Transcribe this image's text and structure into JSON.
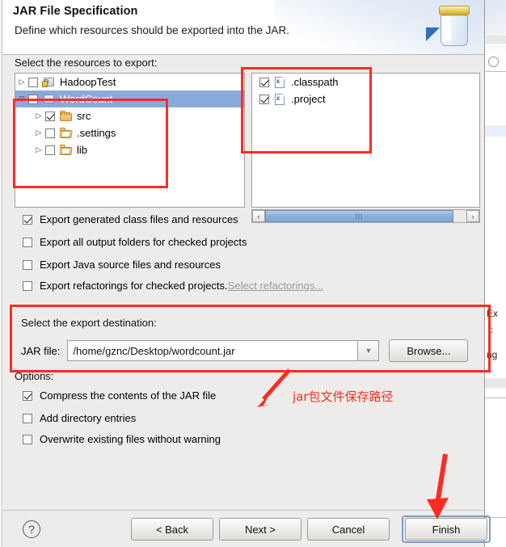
{
  "header": {
    "title": "JAR File Specification",
    "subtitle": "Define which resources should be exported into the JAR.",
    "icon": "jar-icon"
  },
  "resources": {
    "label": "Select the resources to export:",
    "tree": [
      {
        "label": "HadoopTest",
        "state": "unchecked",
        "expanded": false,
        "selected": false,
        "icon": "project-locked-icon",
        "indent": 0
      },
      {
        "label": "WordCount",
        "state": "partial",
        "expanded": true,
        "selected": true,
        "icon": "project-open-icon",
        "indent": 0
      },
      {
        "label": "src",
        "state": "checked",
        "expanded": false,
        "selected": false,
        "icon": "package-folder-icon",
        "indent": 1
      },
      {
        "label": ".settings",
        "state": "unchecked",
        "expanded": false,
        "selected": false,
        "icon": "folder-icon",
        "indent": 1
      },
      {
        "label": "lib",
        "state": "unchecked",
        "expanded": false,
        "selected": false,
        "icon": "folder-icon",
        "indent": 1
      }
    ],
    "files": [
      {
        "label": ".classpath",
        "state": "checked",
        "icon": "xml-file-icon"
      },
      {
        "label": ".project",
        "state": "checked",
        "icon": "xml-file-icon"
      }
    ],
    "scrollbar": {
      "left_arrow": "‹",
      "right_arrow": "›",
      "grip": "|||"
    }
  },
  "export_options": [
    {
      "label": "Export generated class files and resources",
      "state": "checked"
    },
    {
      "label": "Export all output folders for checked projects",
      "state": "unchecked"
    },
    {
      "label": "Export Java source files and resources",
      "state": "unchecked"
    },
    {
      "label": "Export refactorings for checked projects.",
      "state": "unchecked",
      "link": "Select refactorings..."
    }
  ],
  "destination": {
    "label": "Select the export destination:",
    "field_label": "JAR file:",
    "path": "/home/gznc/Desktop/wordcount.jar",
    "dropdown_icon": "chevron-down-icon",
    "browse_label": "Browse..."
  },
  "options": {
    "label": "Options:",
    "items": [
      {
        "label": "Compress the contents of the JAR file",
        "state": "checked"
      },
      {
        "label": "Add directory entries",
        "state": "unchecked"
      },
      {
        "label": "Overwrite existing files without warning",
        "state": "unchecked"
      }
    ]
  },
  "footer": {
    "help_icon": "?",
    "back_label": "< Back",
    "next_label": "Next >",
    "cancel_label": "Cancel",
    "finish_label": "Finish"
  },
  "annotations": {
    "note_text": "jar包文件保存路径",
    "accent_color": "#fb2c23"
  },
  "background": {
    "fragments": [
      "Ex",
      "c",
      "ng"
    ]
  }
}
